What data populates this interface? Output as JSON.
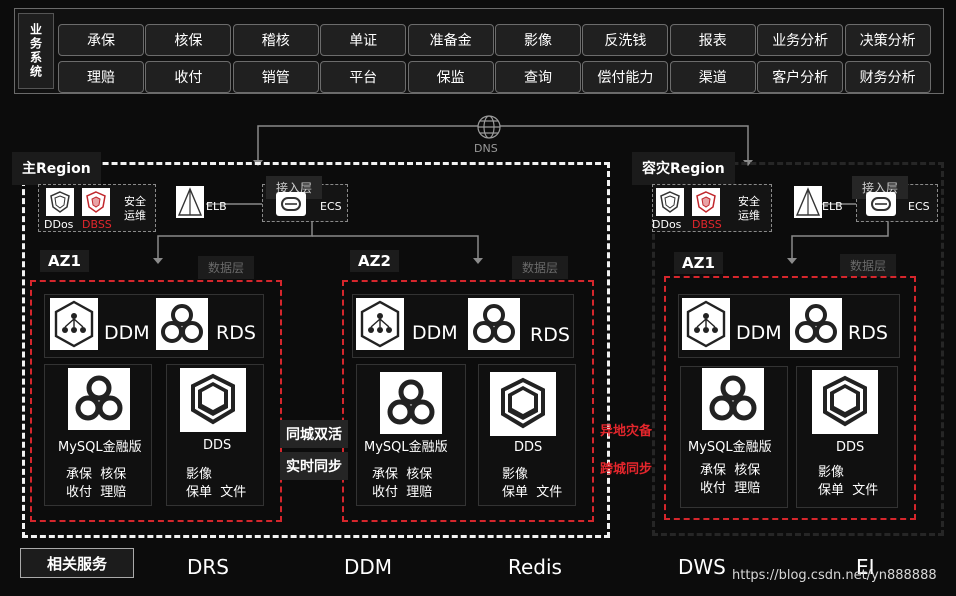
{
  "business": {
    "label": "业务系统",
    "row1": [
      "承保",
      "核保",
      "稽核",
      "单证",
      "准备金",
      "影像",
      "反洗钱",
      "报表",
      "业务分析",
      "决策分析"
    ],
    "row2": [
      "理赔",
      "收付",
      "销管",
      "平台",
      "保监",
      "查询",
      "偿付能力",
      "渠道",
      "客户分析",
      "财务分析"
    ]
  },
  "dns": "DNS",
  "main_region": {
    "title": "主Region",
    "ddos": "DDos",
    "dbss": "DBSS",
    "security_ops": "安全\n运维",
    "elb": "ELB",
    "ecs": "ECS",
    "access_layer": "接入层",
    "data_layer_1": "数据层",
    "data_layer_2": "数据层",
    "az1": {
      "label": "AZ1",
      "ddm": "DDM",
      "rds": "RDS",
      "mysql": "MySQL金融版",
      "dds": "DDS",
      "mysql_apps": "承保  核保\n收付  理赔",
      "dds_apps": "影像\n保单  文件"
    },
    "az2": {
      "label": "AZ2",
      "ddm": "DDM",
      "rds": "RDS",
      "mysql": "MySQL金融版",
      "dds": "DDS",
      "mysql_apps": "承保  核保\n收付  理赔",
      "dds_apps": "影像\n保单  文件"
    }
  },
  "sync": {
    "same_city": "同城双活",
    "realtime": "实时同步",
    "remote_dr": "异地灾备",
    "cross_city": "跨城同步"
  },
  "dr_region": {
    "title": "容灾Region",
    "ddos": "DDos",
    "dbss": "DBSS",
    "security_ops": "安全\n运维",
    "elb": "ELB",
    "ecs": "ECS",
    "access_layer": "接入层",
    "data_layer": "数据层",
    "az1": {
      "label": "AZ1",
      "ddm": "DDM",
      "rds": "RDS",
      "mysql": "MySQL金融版",
      "dds": "DDS",
      "mysql_apps": "承保  核保\n收付  理赔",
      "dds_apps": "影像\n保单  文件"
    }
  },
  "services": {
    "label": "相关服务",
    "items": [
      "DRS",
      "DDM",
      "Redis",
      "DWS",
      "EI"
    ]
  },
  "watermark": "https://blog.csdn.net/yn888888",
  "colors": {
    "accent_red": "#e3262c",
    "background": "#0c0c0c",
    "frame": "#f2f2f2"
  }
}
